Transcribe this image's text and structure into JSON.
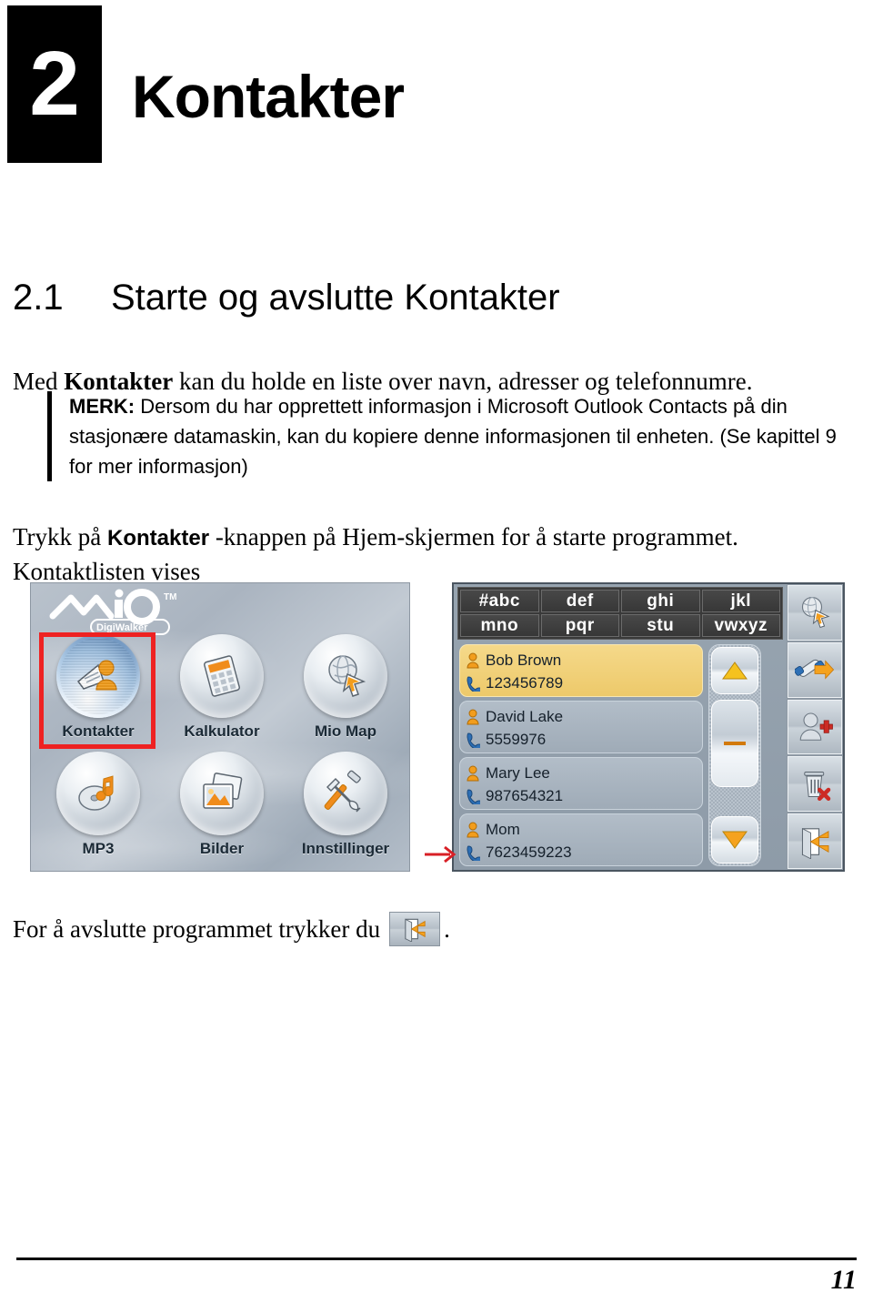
{
  "chapter": {
    "number": "2",
    "title": "Kontakter"
  },
  "section": {
    "number": "2.1",
    "title": "Starte og avslutte Kontakter"
  },
  "intro": {
    "before": "Med ",
    "bold": "Kontakter",
    "after": " kan du holde en liste over navn, adresser og telefonnumre."
  },
  "note": {
    "label": "MERK:",
    "text": " Dersom du har opprettett informasjon i Microsoft Outlook Contacts på din stasjonære datamaskin, kan du kopiere denne informasjonen til enheten. (Se kapittel 9 for mer informasjon)"
  },
  "instruction": {
    "before": "Trykk på ",
    "bold": "Kontakter",
    "after": " -knappen på Hjem-skjermen for å starte programmet. Kontaktlisten vises"
  },
  "figure": {
    "home_screen": {
      "logo_text": "mio",
      "logo_trademark": "TM",
      "logo_sub": "DigiWalker",
      "selected_app": "Kontakter",
      "apps": [
        {
          "label": "Kontakter",
          "icon": "contacts-icon",
          "selected": true
        },
        {
          "label": "Kalkulator",
          "icon": "calculator-icon",
          "selected": false
        },
        {
          "label": "Mio Map",
          "icon": "map-globe-icon",
          "selected": false
        },
        {
          "label": "MP3",
          "icon": "music-disc-icon",
          "selected": false
        },
        {
          "label": "Bilder",
          "icon": "pictures-icon",
          "selected": false
        },
        {
          "label": "Innstillinger",
          "icon": "tools-icon",
          "selected": false
        }
      ]
    },
    "flow_arrow": {
      "icon": "right-arrow-icon",
      "color": "#d81f26"
    },
    "contacts_screen": {
      "keypad_keys": [
        "#abc",
        "def",
        "ghi",
        "jkl",
        "mno",
        "pqr",
        "stu",
        "vwxyz"
      ],
      "contacts": [
        {
          "name": "Bob Brown",
          "phone": "123456789",
          "highlighted": true
        },
        {
          "name": "David Lake",
          "phone": "5559976",
          "highlighted": false
        },
        {
          "name": "Mary Lee",
          "phone": "987654321",
          "highlighted": false
        },
        {
          "name": "Mom",
          "phone": "7623459223",
          "highlighted": false
        }
      ],
      "scrollbar": {
        "up_icon": "scroll-up-arrow-icon",
        "thumb_icon": "scroll-thumb-dash-icon",
        "down_icon": "scroll-down-arrow-icon"
      },
      "toolbar_buttons": [
        {
          "icon": "navigate-globe-icon",
          "name": "navigate-button"
        },
        {
          "icon": "call-phone-icon",
          "name": "call-button"
        },
        {
          "icon": "add-contact-icon",
          "name": "add-contact-button"
        },
        {
          "icon": "delete-trash-icon",
          "name": "delete-contact-button"
        },
        {
          "icon": "back-arrow-icon",
          "name": "back-button"
        }
      ]
    }
  },
  "exit": {
    "text": "For å avslutte programmet trykker du",
    "button_icon": "back-arrow-icon",
    "period": "."
  },
  "footer": {
    "page_number": "11"
  },
  "colors": {
    "highlight_red": "#ee2222",
    "selected_row": "#edc96a",
    "accent_orange": "#f2a01e"
  }
}
